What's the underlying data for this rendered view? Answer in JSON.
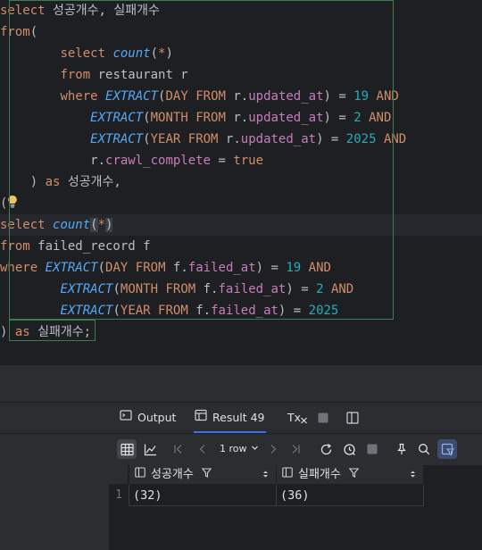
{
  "editor": {
    "l1": {
      "a": "select",
      "b": " 성공개수, 실패개수"
    },
    "l2": {
      "a": "from",
      "b": "("
    },
    "l3": {
      "a": "select",
      "b": "count",
      "c": "(",
      "d": "*",
      "e": ")"
    },
    "l4": {
      "a": "from",
      "b": " restaurant r"
    },
    "l5": {
      "a": "where",
      "b": "EXTRACT",
      "c": "(",
      "d": "DAY",
      "e": "FROM",
      "f": " r.",
      "g": "updated_at",
      "h": ") = ",
      "i": "19",
      "j": "AND"
    },
    "l6": {
      "b": "EXTRACT",
      "c": "(",
      "d": "MONTH",
      "e": "FROM",
      "f": " r.",
      "g": "updated_at",
      "h": ") = ",
      "i": "2",
      "j": "AND"
    },
    "l7": {
      "b": "EXTRACT",
      "c": "(",
      "d": "YEAR",
      "e": "FROM",
      "f": " r.",
      "g": "updated_at",
      "h": ") = ",
      "i": "2025",
      "j": "AND"
    },
    "l8": {
      "f": "r.",
      "g": "crawl_complete",
      "h": " = ",
      "k": "true"
    },
    "l9": {
      "a": ") ",
      "b": "as",
      "c": " 성공개수,"
    },
    "l10": {
      "a": "("
    },
    "l11": {
      "a": "select",
      "b": "count",
      "c": "(",
      "d": "*",
      "e": ")"
    },
    "l12": {
      "a": "from",
      "b": " failed_record f"
    },
    "l13": {
      "a": "where",
      "b": "EXTRACT",
      "c": "(",
      "d": "DAY",
      "e": "FROM",
      "f": " f.",
      "g": "failed_at",
      "h": ") = ",
      "i": "19",
      "j": "AND"
    },
    "l14": {
      "b": "EXTRACT",
      "c": "(",
      "d": "MONTH",
      "e": "FROM",
      "f": " f.",
      "g": "failed_at",
      "h": ") = ",
      "i": "2",
      "j": "AND"
    },
    "l15": {
      "b": "EXTRACT",
      "c": "(",
      "d": "YEAR",
      "e": "FROM",
      "f": " f.",
      "g": "failed_at",
      "h": ") = ",
      "i": "2025"
    },
    "l16": {
      "a": ") ",
      "b": "as",
      "c": " 실패개수",
      "d": ";"
    }
  },
  "panel": {
    "tabs": {
      "output": "Output",
      "result": "Result 49",
      "tx": "Tx"
    },
    "toolbar": {
      "rows": "1 row"
    }
  },
  "grid": {
    "columns": [
      "성공개수",
      "실패개수"
    ],
    "rows": [
      {
        "num": "1",
        "cells": [
          "(32)",
          "(36)"
        ]
      }
    ]
  },
  "colors": {
    "keyword": "#cf8e6d",
    "function": "#56a8f5",
    "field": "#c77dbb",
    "number": "#2aacb8",
    "accent": "#3574f0"
  },
  "icons": [
    "lightbulb-icon",
    "output-icon",
    "table-icon",
    "transaction-icon",
    "stop-icon",
    "layout-icon",
    "grid-view-icon",
    "chart-icon",
    "first-page-icon",
    "prev-page-icon",
    "chevron-down-icon",
    "next-page-icon",
    "last-page-icon",
    "refresh-icon",
    "history-icon",
    "pin-icon",
    "search-icon",
    "filter-view-icon",
    "column-icon",
    "sort-icon"
  ]
}
